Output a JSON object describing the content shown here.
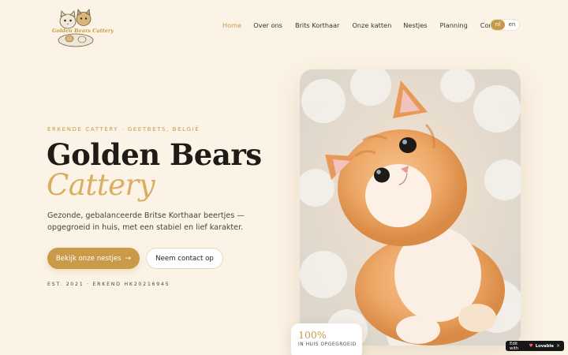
{
  "brand": {
    "logo_text": "Golden Bears Cattery"
  },
  "nav": {
    "items": [
      {
        "label": "Home",
        "active": true
      },
      {
        "label": "Over ons",
        "active": false
      },
      {
        "label": "Brits Korthaar",
        "active": false
      },
      {
        "label": "Onze katten",
        "active": false
      },
      {
        "label": "Nestjes",
        "active": false
      },
      {
        "label": "Planning",
        "active": false
      },
      {
        "label": "Contact",
        "active": false
      }
    ],
    "languages": {
      "selected": "nl",
      "other": "en"
    }
  },
  "hero": {
    "eyebrow": "ERKENDE CATTERY · GEETBETS, BELGIË",
    "title_line1": "Golden Bears",
    "title_line2": "Cattery",
    "lead": "Gezonde, gebalanceerde Britse Korthaar beertjes — opgegroeid in huis, met een stabiel en lief karakter.",
    "primary_button": "Bekijk onze nestjes",
    "primary_icon": "arrow-right-icon",
    "secondary_button": "Neem contact op",
    "meta": "EST. 2021 · ERKEND HK20216945"
  },
  "stat": {
    "value": "100%",
    "label": "IN HUIS OPGEGROEID"
  },
  "badge": {
    "prefix": "Edit with",
    "brand": "Lovable",
    "close": "×"
  },
  "colors": {
    "background": "#fbf3e6",
    "accent": "#c99a4a",
    "accent_light": "#d9ae63",
    "text": "#2a2520"
  }
}
